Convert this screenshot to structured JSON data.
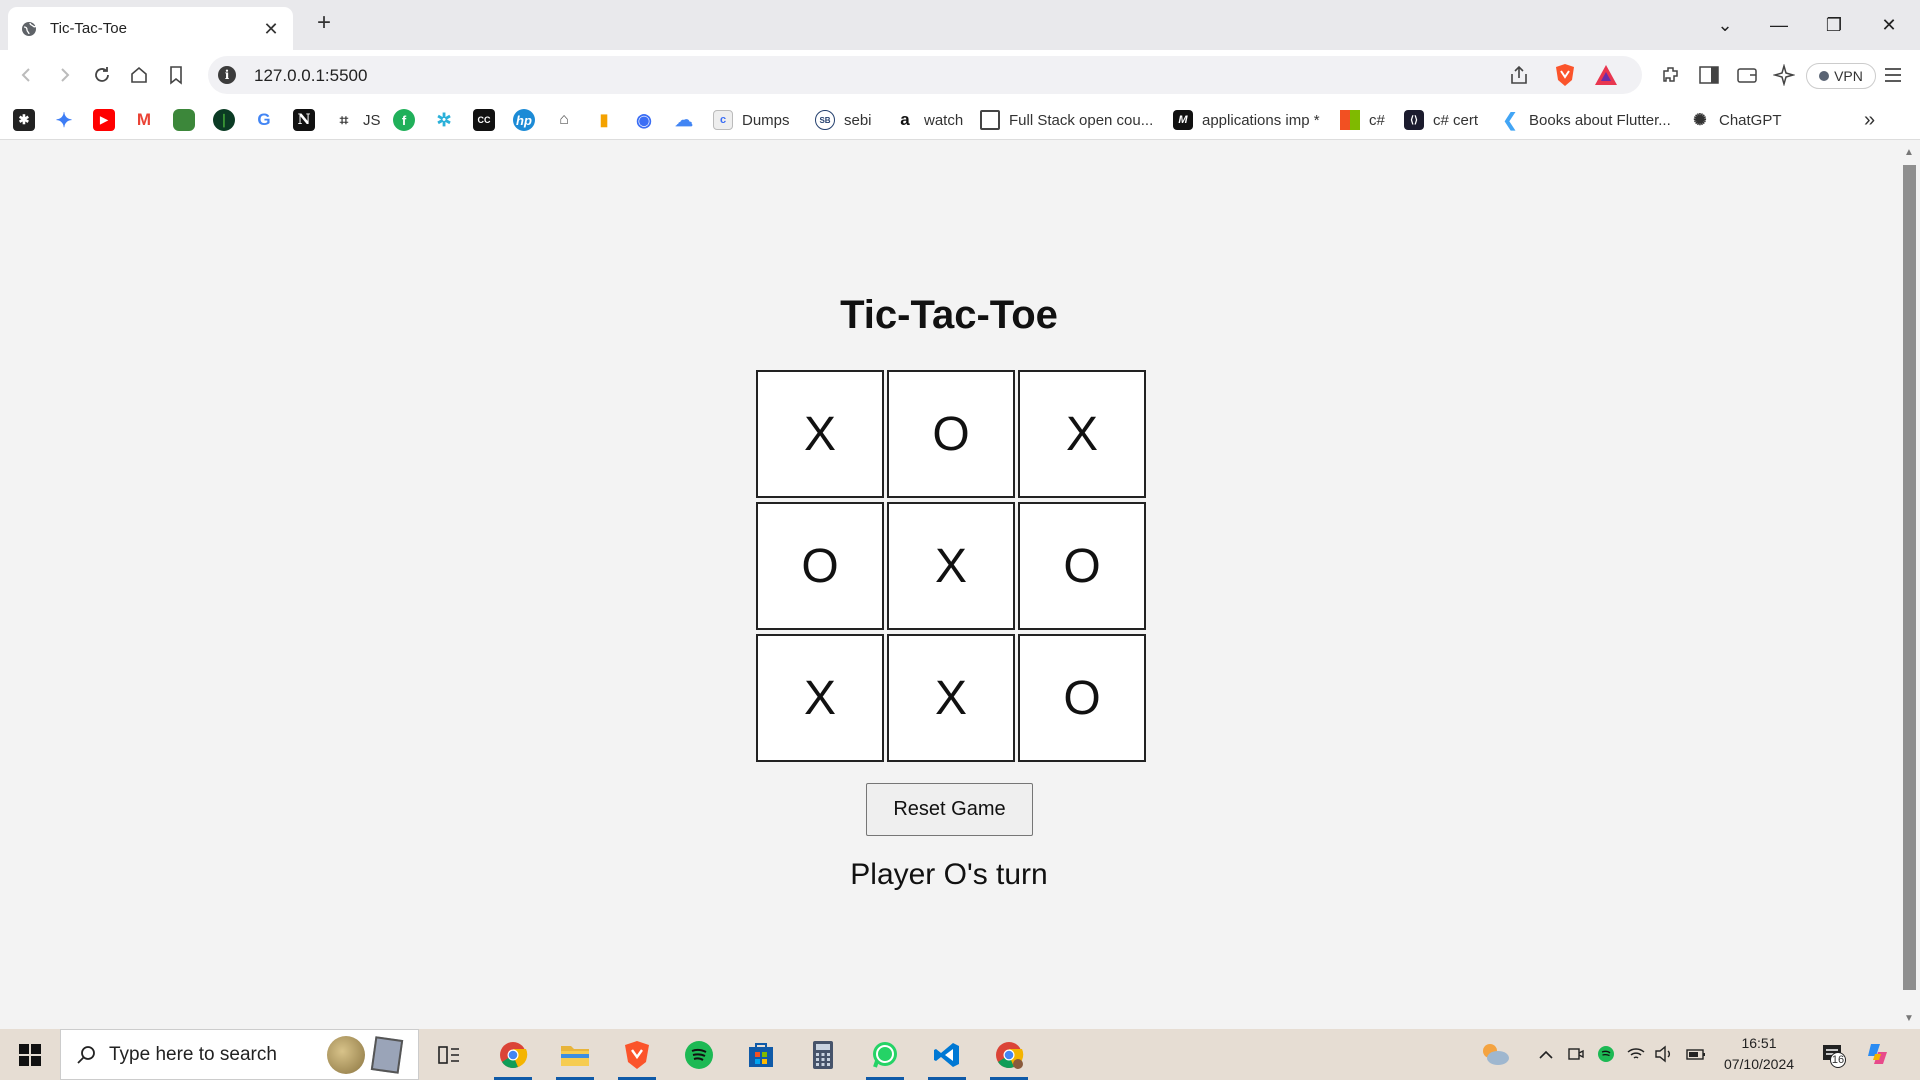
{
  "browser": {
    "tab_title": "Tic-Tac-Toe",
    "new_tab_label": "+",
    "url": "127.0.0.1:5500",
    "vpn_label": "VPN",
    "window_controls": {
      "minimize": "—",
      "restore": "❐",
      "close": "✕"
    }
  },
  "bookmarks": {
    "icons": [
      {
        "name": "bookmark-icon-1",
        "glyph": "✱",
        "color": "#222"
      },
      {
        "name": "gemini-icon",
        "glyph": "✦",
        "color": "#3d7df5"
      },
      {
        "name": "youtube-icon",
        "glyph": "▶",
        "color": "#ff0000"
      },
      {
        "name": "gmail-icon",
        "glyph": "M",
        "color": "#ea4335"
      },
      {
        "name": "nodejs-icon",
        "glyph": "⬢",
        "color": "#3c873a"
      },
      {
        "name": "mongodb-icon",
        "glyph": "●",
        "color": "#0b3b24"
      },
      {
        "name": "google-icon",
        "glyph": "G",
        "color": "#4285f4"
      },
      {
        "name": "notion-icon",
        "glyph": "N",
        "color": "#111"
      }
    ],
    "items": [
      {
        "label": "JS",
        "icon": "js-icon"
      },
      {
        "label": "Dumps",
        "icon": "dumps-icon"
      },
      {
        "label": "sebi",
        "icon": "sebi-icon"
      },
      {
        "label": "watch",
        "icon": "amazon-icon"
      },
      {
        "label": "Full Stack open cou...",
        "icon": "page-icon"
      },
      {
        "label": "applications imp *",
        "icon": "medium-icon"
      },
      {
        "label": "c#",
        "icon": "microsoft-icon"
      },
      {
        "label": "c# cert",
        "icon": "cert-icon"
      },
      {
        "label": "Books about Flutter...",
        "icon": "flutter-icon"
      },
      {
        "label": "ChatGPT",
        "icon": "chatgpt-icon"
      }
    ],
    "overflow": "»"
  },
  "game": {
    "title": "Tic-Tac-Toe",
    "cells": [
      "X",
      "O",
      "X",
      "O",
      "X",
      "O",
      "X",
      "X",
      "O"
    ],
    "reset_label": "Reset Game",
    "status": "Player O's turn"
  },
  "taskbar": {
    "search_placeholder": "Type here to search",
    "time": "16:51",
    "date": "07/10/2024",
    "notification_count": "16"
  }
}
